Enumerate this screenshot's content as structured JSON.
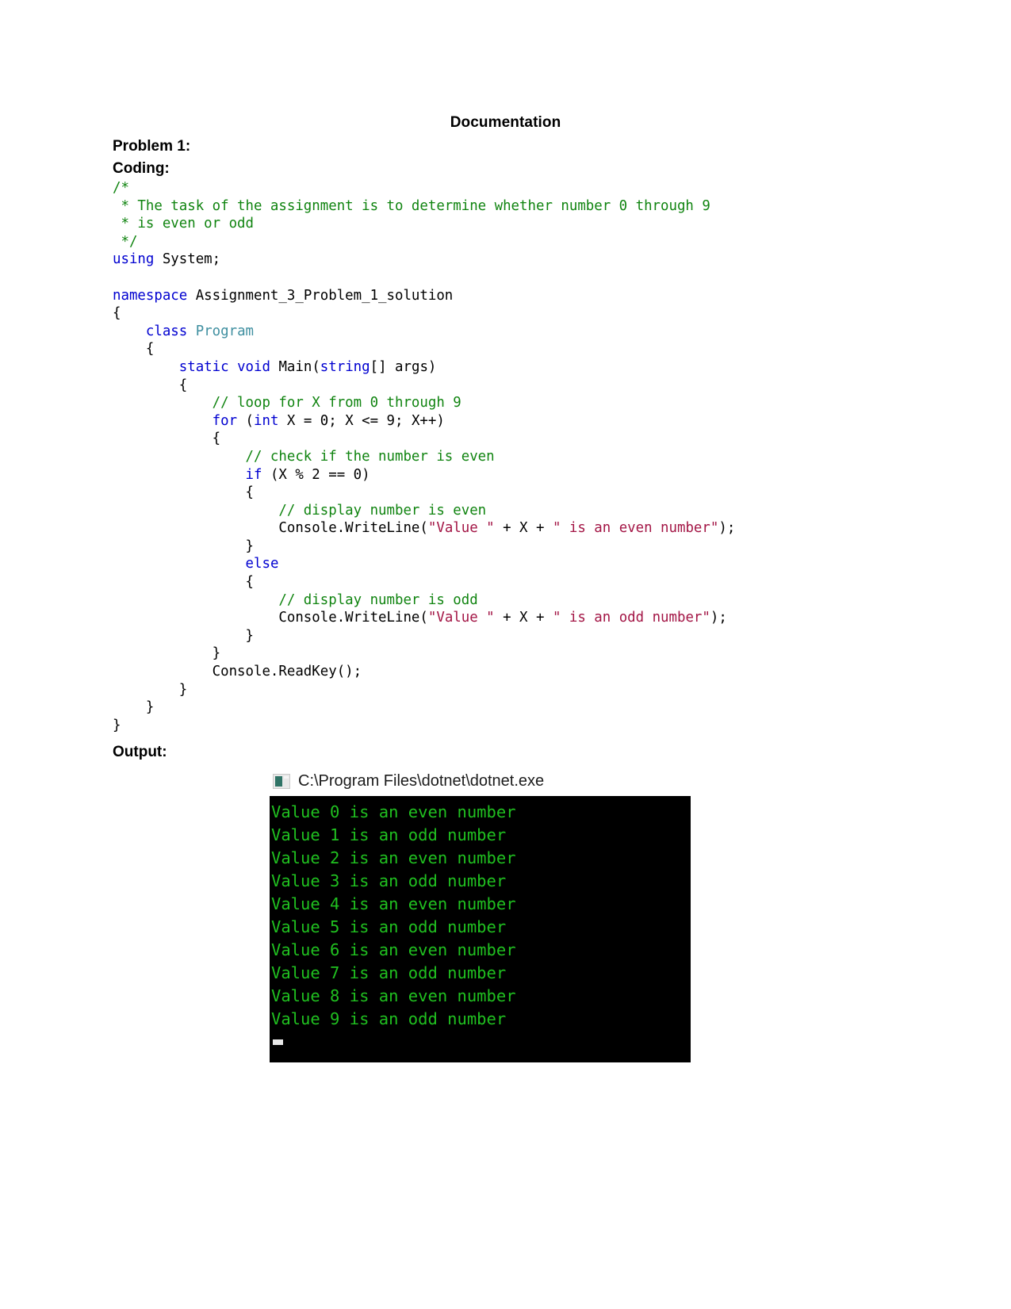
{
  "document": {
    "title": "Documentation",
    "sections": {
      "problem_label": "Problem 1:",
      "coding_label": "Coding:",
      "output_label": "Output:"
    }
  },
  "code": {
    "language": "csharp",
    "colors": {
      "keyword": "#0000d0",
      "comment": "#108410",
      "type": "#3f8fa0",
      "string": "#a31545",
      "default": "#000000"
    },
    "lines": [
      "/*",
      " * The task of the assignment is to determine whether number 0 through 9",
      " * is even or odd",
      " */",
      "using System;",
      "",
      "namespace Assignment_3_Problem_1_solution",
      "{",
      "    class Program",
      "    {",
      "        static void Main(string[] args)",
      "        {",
      "            // loop for X from 0 through 9",
      "            for (int X = 0; X <= 9; X++)",
      "            {",
      "                // check if the number is even",
      "                if (X % 2 == 0)",
      "                {",
      "                    // display number is even",
      "                    Console.WriteLine(\"Value \" + X + \" is an even number\");",
      "                }",
      "                else",
      "                {",
      "                    // display number is odd",
      "                    Console.WriteLine(\"Value \" + X + \" is an odd number\");",
      "                }",
      "            }",
      "            Console.ReadKey();",
      "        }",
      "    }",
      "}"
    ]
  },
  "console": {
    "title": "C:\\Program Files\\dotnet\\dotnet.exe",
    "icon": "console-window-icon",
    "background_color": "#000000",
    "text_color": "#20c020",
    "output_lines": [
      "Value 0 is an even number",
      "Value 1 is an odd number",
      "Value 2 is an even number",
      "Value 3 is an odd number",
      "Value 4 is an even number",
      "Value 5 is an odd number",
      "Value 6 is an even number",
      "Value 7 is an odd number",
      "Value 8 is an even number",
      "Value 9 is an odd number"
    ],
    "cursor": "_"
  }
}
